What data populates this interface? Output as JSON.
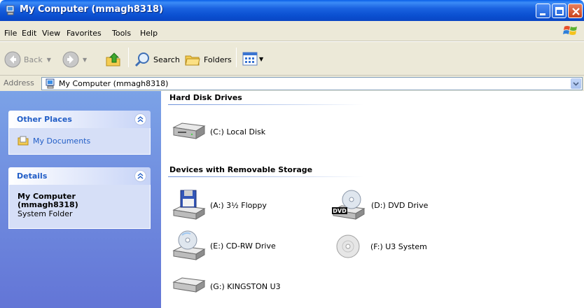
{
  "window": {
    "title": "My Computer (mmagh8318)"
  },
  "menu": [
    "File",
    "Edit",
    "View",
    "Favorites",
    "Tools",
    "Help"
  ],
  "toolbar": {
    "back_label": "Back",
    "search_label": "Search",
    "folders_label": "Folders"
  },
  "address": {
    "label": "Address",
    "value": "My Computer (mmagh8318)"
  },
  "left_pane": {
    "other_places": {
      "title": "Other Places",
      "links": [
        "My Documents"
      ]
    },
    "details": {
      "title": "Details",
      "name_line1": "My Computer",
      "name_line2": "(mmagh8318)",
      "type": "System Folder"
    }
  },
  "content": {
    "groups": [
      {
        "title": "Hard Disk Drives",
        "items": [
          {
            "label": "(C:) Local Disk",
            "icon": "hard-disk-icon"
          }
        ]
      },
      {
        "title": "Devices with Removable Storage",
        "items": [
          {
            "label": "(A:) 3½ Floppy",
            "icon": "floppy-drive-icon"
          },
          {
            "label": "(D:) DVD Drive",
            "icon": "dvd-drive-icon"
          },
          {
            "label": "(E:) CD-RW Drive",
            "icon": "cd-drive-icon"
          },
          {
            "label": "(F:) U3 System",
            "icon": "cd-disc-icon"
          },
          {
            "label": "(G:) KINGSTON U3",
            "icon": "removable-disk-icon"
          }
        ]
      }
    ]
  },
  "colors": {
    "title_bar": "#0a4fd0",
    "task_pane": "#6375d6",
    "link": "#215dc6"
  }
}
